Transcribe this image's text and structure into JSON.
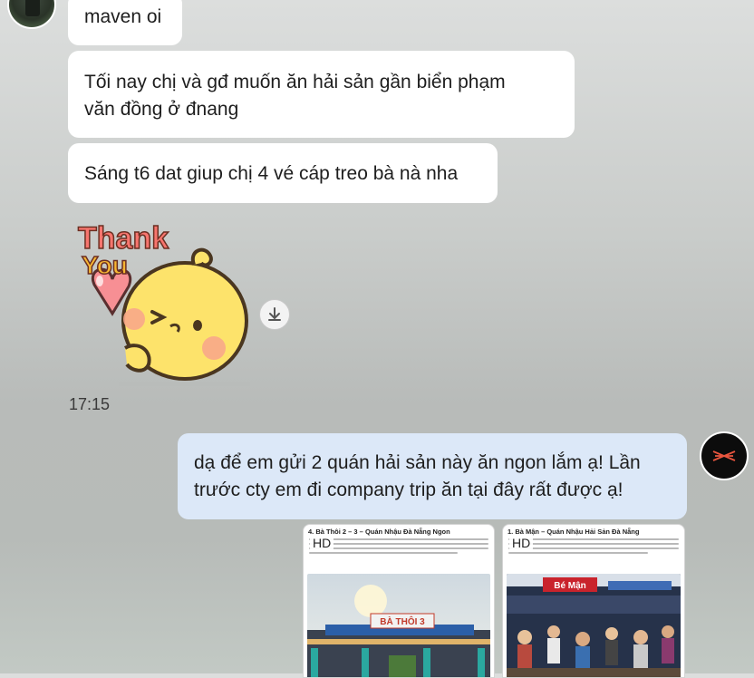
{
  "messages": {
    "m1": "maven oi",
    "m2_line1": "Tối nay chị và gđ muốn ăn hải sản gần biển phạm",
    "m2_line2": "văn đồng ở đnang",
    "m3": "Sáng t6 dat giup chị 4 vé cáp treo bà nà nha",
    "sticker_text_1": "Thank",
    "sticker_text_2": "You",
    "timestamp": "17:15",
    "reply_line1": "dạ để em gửi 2 quán hải sản này ăn ngon lắm ạ! Lần",
    "reply_line2": "trước cty em đi company trip ăn tại đây rất được ạ!"
  },
  "attachments": [
    {
      "title": "4. Bà Thôi 2 – 3 – Quán Nhậu Đà Nẵng Ngon",
      "badge": "HD",
      "sign_text": "BÀ THÔI 3"
    },
    {
      "title": "1. Bà Mận – Quán Nhậu Hải Sản Đà Nẵng",
      "badge": "HD",
      "sign_text": "Bé Mận"
    }
  ],
  "colors": {
    "incoming_bubble": "#ffffff",
    "outgoing_bubble": "#dce8f8",
    "text": "#1e1e1e",
    "sticker_chick": "#fde36b",
    "sticker_heart": "#f78f94",
    "sticker_text": "#f7756e"
  },
  "icons": {
    "download": "download-icon",
    "profile": "brand-logo-icon"
  }
}
